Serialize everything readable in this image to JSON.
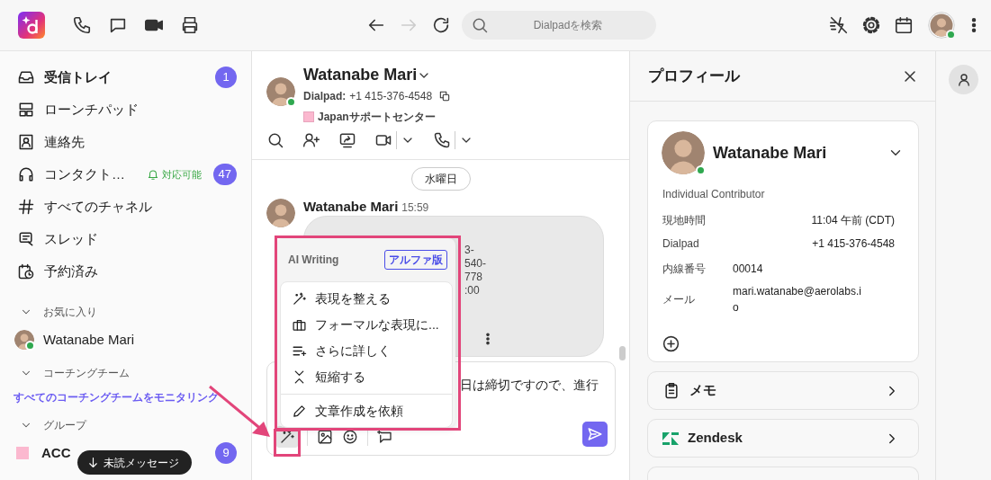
{
  "topbar": {
    "search": {
      "placeholder": "Dialpadを検索"
    },
    "user_online": true
  },
  "sidebar": {
    "nav": [
      {
        "label": "受信トレイ",
        "unread": true,
        "badge": "1"
      },
      {
        "label": "ローンチパッド",
        "unread": false
      },
      {
        "label": "連絡先",
        "unread": false
      },
      {
        "label": "コンタクト…",
        "unread": false,
        "status": "対応可能",
        "badge": "47"
      },
      {
        "label": "すべてのチャネル",
        "unread": false
      },
      {
        "label": "スレッド",
        "unread": false
      },
      {
        "label": "予約済み",
        "unread": false
      }
    ],
    "sections": [
      {
        "title": "お気に入り",
        "expanded": true,
        "items": [
          {
            "kind": "contact",
            "label": "Watanabe Mari",
            "online": true,
            "unread": false
          }
        ]
      },
      {
        "title": "コーチングチーム",
        "expanded": true,
        "link": "すべてのコーチングチームをモニタリング"
      },
      {
        "title": "グループ",
        "expanded": true,
        "items": [
          {
            "kind": "group",
            "label": "ACC",
            "color": "#fbb8cf",
            "unread": true,
            "badge": "9"
          }
        ]
      }
    ],
    "unread_pill": "未読メッセージ"
  },
  "conversation": {
    "name": "Watanabe Mari",
    "online": true,
    "dialpad_label": "Dialpad:",
    "number": "+1 415-376-4548",
    "tag": {
      "label": "Japanサポートセンター",
      "color": "#fbb8cf"
    },
    "date_divider": "水曜日",
    "messages": [
      {
        "author": "Watanabe Mari",
        "time": "15:59",
        "fragments": [
          "3-",
          "540-",
          "778",
          ":00"
        ]
      }
    ],
    "composer": {
      "value": "日は締切ですので、進行"
    }
  },
  "ai_menu": {
    "title": "AI Writing",
    "badge": "アルファ版",
    "items": [
      {
        "label": "表現を整える"
      },
      {
        "label": "フォーマルな表現に..."
      },
      {
        "label": "さらに詳しく"
      },
      {
        "label": "短縮する"
      }
    ],
    "action": "文章作成を依頼"
  },
  "profile": {
    "title": "プロフィール",
    "name": "Watanabe Mari",
    "online": true,
    "role": "Individual Contributor",
    "fields": [
      {
        "kind": "split",
        "label": "現地時間",
        "value": "11:04 午前 (CDT)"
      },
      {
        "kind": "split",
        "label": "Dialpad",
        "value": "+1 415-376-4548"
      },
      {
        "kind": "column",
        "label": "内線番号",
        "value": "00014"
      },
      {
        "kind": "column",
        "label": "メール",
        "value": "mari.watanabe@aerolabs.io"
      }
    ],
    "sections": [
      {
        "label": "メモ"
      },
      {
        "label": "Zendesk"
      }
    ]
  }
}
